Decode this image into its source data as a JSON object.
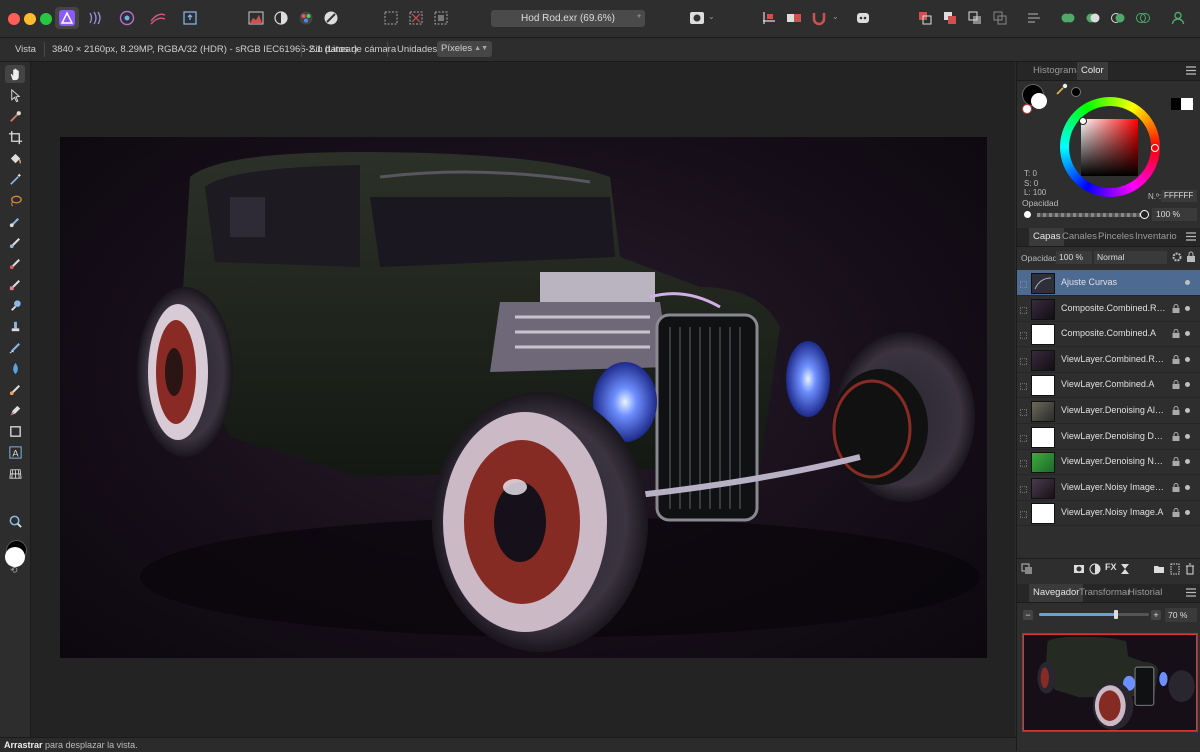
{
  "window": {
    "document_title": "Hod Rod.exr (69.6%)",
    "modified_star": "*"
  },
  "context_bar": {
    "persona": "Vista",
    "image_info": "3840 × 2160px, 8.29MP, RGBA/32 (HDR) - sRGB IEC61966-2.1 (Linear)",
    "camera_info": "Sin datos de cámara",
    "units_label": "Unidades:",
    "units_value": "Píxeles"
  },
  "color_panel": {
    "tabs": [
      "Histograma",
      "Color"
    ],
    "active_tab": "Color",
    "tsl": {
      "t": "T: 0",
      "s": "S: 0",
      "l": "L: 100"
    },
    "hex_label": "N.º:",
    "hex_value": "FFFFFF",
    "opacity_label": "Opacidad",
    "opacity_value": "100 %"
  },
  "layers_panel": {
    "tabs": [
      "Capas",
      "Canales",
      "Pinceles",
      "Inventario"
    ],
    "active_tab": "Capas",
    "opacity_label": "Opacidad:",
    "opacity_value": "100 %",
    "blend_mode": "Normal",
    "layers": [
      {
        "name": "Ajuste Curvas",
        "selected": true
      },
      {
        "name": "Composite.Combined.RGB",
        "selected": false
      },
      {
        "name": "Composite.Combined.A",
        "selected": false
      },
      {
        "name": "ViewLayer.Combined.RGB",
        "selected": false
      },
      {
        "name": "ViewLayer.Combined.A",
        "selected": false
      },
      {
        "name": "ViewLayer.Denoising Albedo.RGB",
        "selected": false
      },
      {
        "name": "ViewLayer.Denoising Depth.[Z]",
        "selected": false
      },
      {
        "name": "ViewLayer.Denoising Normal.RGB",
        "selected": false
      },
      {
        "name": "ViewLayer.Noisy Image.RGB",
        "selected": false
      },
      {
        "name": "ViewLayer.Noisy Image.A",
        "selected": false
      }
    ]
  },
  "navigator_panel": {
    "tabs": [
      "Navegador",
      "Transformar",
      "Historial"
    ],
    "active_tab": "Navegador",
    "zoom_value": "70 %",
    "zoom_fraction": 0.7
  },
  "status_bar": {
    "tool_name": "Arrastrar",
    "hint": " para desplazar la vista."
  },
  "colors": {
    "accent_purple": "#7a4cd9",
    "selection_blue": "#4d6a93",
    "primary_color": "#ffffff",
    "secondary_color": "#000000"
  },
  "icons": {
    "tools": [
      "hand-icon",
      "move-icon",
      "color-picker-icon",
      "crop-icon",
      "flood-fill-icon",
      "magic-wand-icon",
      "lasso-icon",
      "selection-brush-icon",
      "paint-brush-icon",
      "pixel-brush-icon",
      "erase-brush-icon",
      "dodge-icon",
      "burn-icon",
      "clone-icon",
      "smudge-icon",
      "blur-icon",
      "pen-icon",
      "rectangle-icon",
      "text-icon",
      "mesh-warp-icon",
      "zoom-icon"
    ]
  }
}
